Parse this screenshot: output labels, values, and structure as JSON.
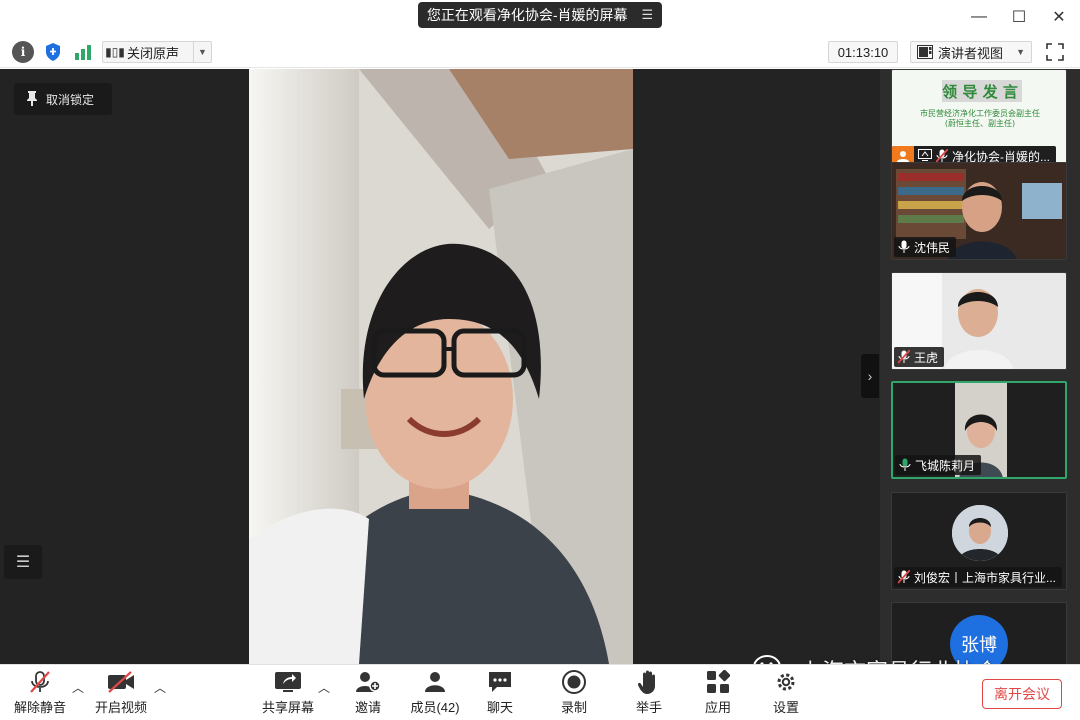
{
  "titlebar": {
    "share_notice": "您正在观看净化协会-肖媛的屏幕"
  },
  "toolbar": {
    "original_sound": "关闭原声",
    "timer": "01:13:10",
    "view_mode": "演讲者视图"
  },
  "stage": {
    "unlock_label": "取消锁定"
  },
  "thumbnails": [
    {
      "name": "净化协会-肖媛的...",
      "slide_title": "领 导 发 言",
      "slide_line1": "市民营经济净化工作委员会副主任",
      "slide_line2": "(蔚恒主任、副主任)"
    },
    {
      "name": "沈伟民"
    },
    {
      "name": "王虎"
    },
    {
      "name": "飞城陈莉月"
    },
    {
      "name": "刘俊宏丨上海市家具行业..."
    },
    {
      "name": "张博",
      "avatar_text": "张博"
    }
  ],
  "bottom": {
    "unmute": "解除静音",
    "start_video": "开启视频",
    "share_screen": "共享屏幕",
    "invite": "邀请",
    "members": "成员(42)",
    "chat": "聊天",
    "record": "录制",
    "raise_hand": "举手",
    "apps": "应用",
    "settings": "设置",
    "leave": "离开会议"
  },
  "watermark": {
    "text": "上海市家具行业协会"
  },
  "colors": {
    "accent_blue": "#1e6fe0",
    "active_green": "#2fa66a",
    "leave_red": "#e04848",
    "mic_off_red": "#e04848"
  }
}
